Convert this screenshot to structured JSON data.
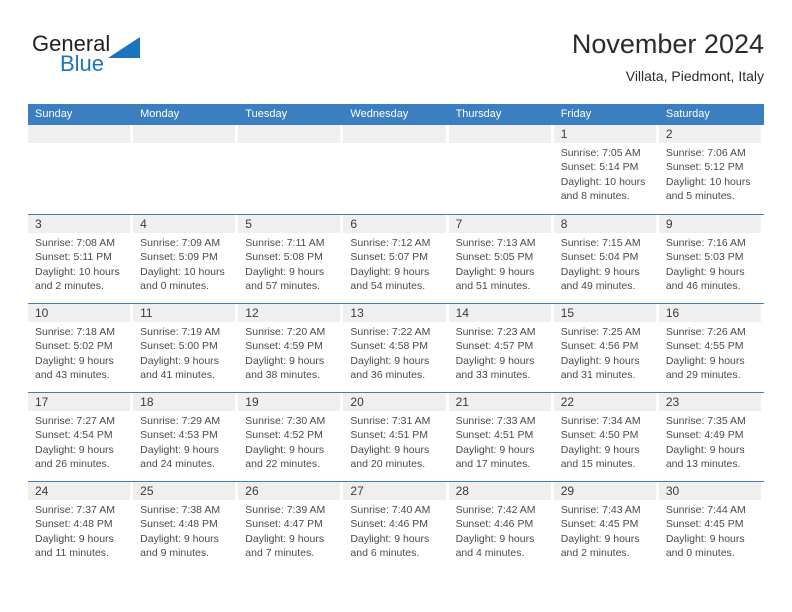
{
  "brand": {
    "word_one": "General",
    "word_two": "Blue",
    "logo_icon": "triangle-logo-icon",
    "colors": {
      "dark": "#231f20",
      "blue": "#1c75bc"
    }
  },
  "header": {
    "title": "November 2024",
    "location": "Villata, Piedmont, Italy"
  },
  "theme": {
    "header_blue": "#3b7fc0",
    "day_band_gray": "#efefef",
    "text": "#4a4a4a"
  },
  "calendar": {
    "weekdays": [
      "Sunday",
      "Monday",
      "Tuesday",
      "Wednesday",
      "Thursday",
      "Friday",
      "Saturday"
    ],
    "weeks": [
      [
        {
          "day": "",
          "lines": []
        },
        {
          "day": "",
          "lines": []
        },
        {
          "day": "",
          "lines": []
        },
        {
          "day": "",
          "lines": []
        },
        {
          "day": "",
          "lines": []
        },
        {
          "day": "1",
          "lines": [
            "Sunrise: 7:05 AM",
            "Sunset: 5:14 PM",
            "Daylight: 10 hours",
            "and 8 minutes."
          ]
        },
        {
          "day": "2",
          "lines": [
            "Sunrise: 7:06 AM",
            "Sunset: 5:12 PM",
            "Daylight: 10 hours",
            "and 5 minutes."
          ]
        }
      ],
      [
        {
          "day": "3",
          "lines": [
            "Sunrise: 7:08 AM",
            "Sunset: 5:11 PM",
            "Daylight: 10 hours",
            "and 2 minutes."
          ]
        },
        {
          "day": "4",
          "lines": [
            "Sunrise: 7:09 AM",
            "Sunset: 5:09 PM",
            "Daylight: 10 hours",
            "and 0 minutes."
          ]
        },
        {
          "day": "5",
          "lines": [
            "Sunrise: 7:11 AM",
            "Sunset: 5:08 PM",
            "Daylight: 9 hours",
            "and 57 minutes."
          ]
        },
        {
          "day": "6",
          "lines": [
            "Sunrise: 7:12 AM",
            "Sunset: 5:07 PM",
            "Daylight: 9 hours",
            "and 54 minutes."
          ]
        },
        {
          "day": "7",
          "lines": [
            "Sunrise: 7:13 AM",
            "Sunset: 5:05 PM",
            "Daylight: 9 hours",
            "and 51 minutes."
          ]
        },
        {
          "day": "8",
          "lines": [
            "Sunrise: 7:15 AM",
            "Sunset: 5:04 PM",
            "Daylight: 9 hours",
            "and 49 minutes."
          ]
        },
        {
          "day": "9",
          "lines": [
            "Sunrise: 7:16 AM",
            "Sunset: 5:03 PM",
            "Daylight: 9 hours",
            "and 46 minutes."
          ]
        }
      ],
      [
        {
          "day": "10",
          "lines": [
            "Sunrise: 7:18 AM",
            "Sunset: 5:02 PM",
            "Daylight: 9 hours",
            "and 43 minutes."
          ]
        },
        {
          "day": "11",
          "lines": [
            "Sunrise: 7:19 AM",
            "Sunset: 5:00 PM",
            "Daylight: 9 hours",
            "and 41 minutes."
          ]
        },
        {
          "day": "12",
          "lines": [
            "Sunrise: 7:20 AM",
            "Sunset: 4:59 PM",
            "Daylight: 9 hours",
            "and 38 minutes."
          ]
        },
        {
          "day": "13",
          "lines": [
            "Sunrise: 7:22 AM",
            "Sunset: 4:58 PM",
            "Daylight: 9 hours",
            "and 36 minutes."
          ]
        },
        {
          "day": "14",
          "lines": [
            "Sunrise: 7:23 AM",
            "Sunset: 4:57 PM",
            "Daylight: 9 hours",
            "and 33 minutes."
          ]
        },
        {
          "day": "15",
          "lines": [
            "Sunrise: 7:25 AM",
            "Sunset: 4:56 PM",
            "Daylight: 9 hours",
            "and 31 minutes."
          ]
        },
        {
          "day": "16",
          "lines": [
            "Sunrise: 7:26 AM",
            "Sunset: 4:55 PM",
            "Daylight: 9 hours",
            "and 29 minutes."
          ]
        }
      ],
      [
        {
          "day": "17",
          "lines": [
            "Sunrise: 7:27 AM",
            "Sunset: 4:54 PM",
            "Daylight: 9 hours",
            "and 26 minutes."
          ]
        },
        {
          "day": "18",
          "lines": [
            "Sunrise: 7:29 AM",
            "Sunset: 4:53 PM",
            "Daylight: 9 hours",
            "and 24 minutes."
          ]
        },
        {
          "day": "19",
          "lines": [
            "Sunrise: 7:30 AM",
            "Sunset: 4:52 PM",
            "Daylight: 9 hours",
            "and 22 minutes."
          ]
        },
        {
          "day": "20",
          "lines": [
            "Sunrise: 7:31 AM",
            "Sunset: 4:51 PM",
            "Daylight: 9 hours",
            "and 20 minutes."
          ]
        },
        {
          "day": "21",
          "lines": [
            "Sunrise: 7:33 AM",
            "Sunset: 4:51 PM",
            "Daylight: 9 hours",
            "and 17 minutes."
          ]
        },
        {
          "day": "22",
          "lines": [
            "Sunrise: 7:34 AM",
            "Sunset: 4:50 PM",
            "Daylight: 9 hours",
            "and 15 minutes."
          ]
        },
        {
          "day": "23",
          "lines": [
            "Sunrise: 7:35 AM",
            "Sunset: 4:49 PM",
            "Daylight: 9 hours",
            "and 13 minutes."
          ]
        }
      ],
      [
        {
          "day": "24",
          "lines": [
            "Sunrise: 7:37 AM",
            "Sunset: 4:48 PM",
            "Daylight: 9 hours",
            "and 11 minutes."
          ]
        },
        {
          "day": "25",
          "lines": [
            "Sunrise: 7:38 AM",
            "Sunset: 4:48 PM",
            "Daylight: 9 hours",
            "and 9 minutes."
          ]
        },
        {
          "day": "26",
          "lines": [
            "Sunrise: 7:39 AM",
            "Sunset: 4:47 PM",
            "Daylight: 9 hours",
            "and 7 minutes."
          ]
        },
        {
          "day": "27",
          "lines": [
            "Sunrise: 7:40 AM",
            "Sunset: 4:46 PM",
            "Daylight: 9 hours",
            "and 6 minutes."
          ]
        },
        {
          "day": "28",
          "lines": [
            "Sunrise: 7:42 AM",
            "Sunset: 4:46 PM",
            "Daylight: 9 hours",
            "and 4 minutes."
          ]
        },
        {
          "day": "29",
          "lines": [
            "Sunrise: 7:43 AM",
            "Sunset: 4:45 PM",
            "Daylight: 9 hours",
            "and 2 minutes."
          ]
        },
        {
          "day": "30",
          "lines": [
            "Sunrise: 7:44 AM",
            "Sunset: 4:45 PM",
            "Daylight: 9 hours",
            "and 0 minutes."
          ]
        }
      ]
    ]
  }
}
